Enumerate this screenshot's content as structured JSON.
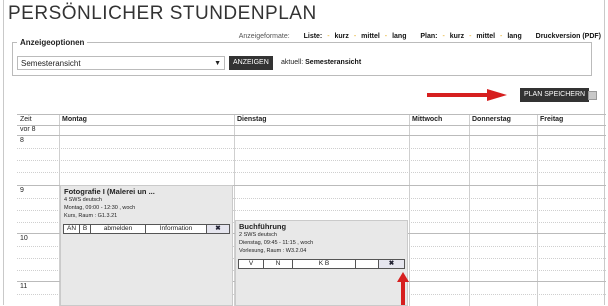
{
  "page": {
    "title": "PERSÖNLICHER STUNDENPLAN"
  },
  "formats": {
    "label": "Anzeigeformate:",
    "list_label": "Liste:",
    "plan_label": "Plan:",
    "kurz": "kurz",
    "mittel": "mittel",
    "lang": "lang",
    "separator": "-",
    "print": "Druckversion (PDF)"
  },
  "options": {
    "legend": "Anzeigeoptionen",
    "select_value": "Semesteransicht",
    "show_button": "ANZEIGEN",
    "current_label": "aktuell:",
    "current_value": "Semesteransicht"
  },
  "save": {
    "button": "PLAN SPEICHERN"
  },
  "timetable": {
    "headers": [
      "Zeit",
      "Montag",
      "Dienstag",
      "Mittwoch",
      "Donnerstag",
      "Freitag"
    ],
    "hours": [
      "vor 8",
      "8",
      "9",
      "10",
      "11"
    ]
  },
  "courses": {
    "c1": {
      "title": "Fotografie I (Malerei un ...",
      "sws": "4 SWS  deutsch",
      "time": "Montag, 09:00 - 12:30 , woch",
      "room": "Kurs, Raum : G1.3.21",
      "actions": [
        "AN",
        "B",
        "abmelden",
        "Information",
        "✖"
      ]
    },
    "c2": {
      "title": "Buchführung",
      "sws": "2 SWS  deutsch",
      "time": "Dienstag, 09:45 - 11:15 , woch",
      "room": "Vorlesung, Raum : W3.2.04",
      "actions": [
        "V",
        "N",
        "K B",
        "",
        "✖"
      ]
    }
  },
  "colors": {
    "arrow": "#d61f1f",
    "button_bg": "#333333",
    "course_bg": "#e8e8e8"
  }
}
